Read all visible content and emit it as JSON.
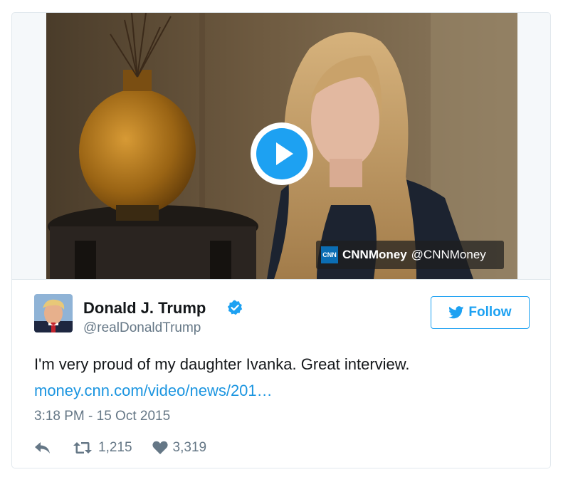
{
  "media": {
    "source_name": "CNNMoney",
    "source_handle": "@CNNMoney",
    "source_logo_text": "CNN",
    "play_icon": "play-icon"
  },
  "author": {
    "name": "Donald J. Trump",
    "handle": "@realDonaldTrump",
    "verified": true
  },
  "follow_label": "Follow",
  "tweet_text": "I'm very proud of my daughter Ivanka. Great interview.",
  "link_text": "money.cnn.com/video/news/201…",
  "timestamp": "3:18 PM - 15 Oct 2015",
  "actions": {
    "retweets": "1,215",
    "likes": "3,319"
  },
  "colors": {
    "accent": "#1da1f2",
    "link": "#1b95e0",
    "muted": "#657786",
    "text": "#14171a"
  }
}
